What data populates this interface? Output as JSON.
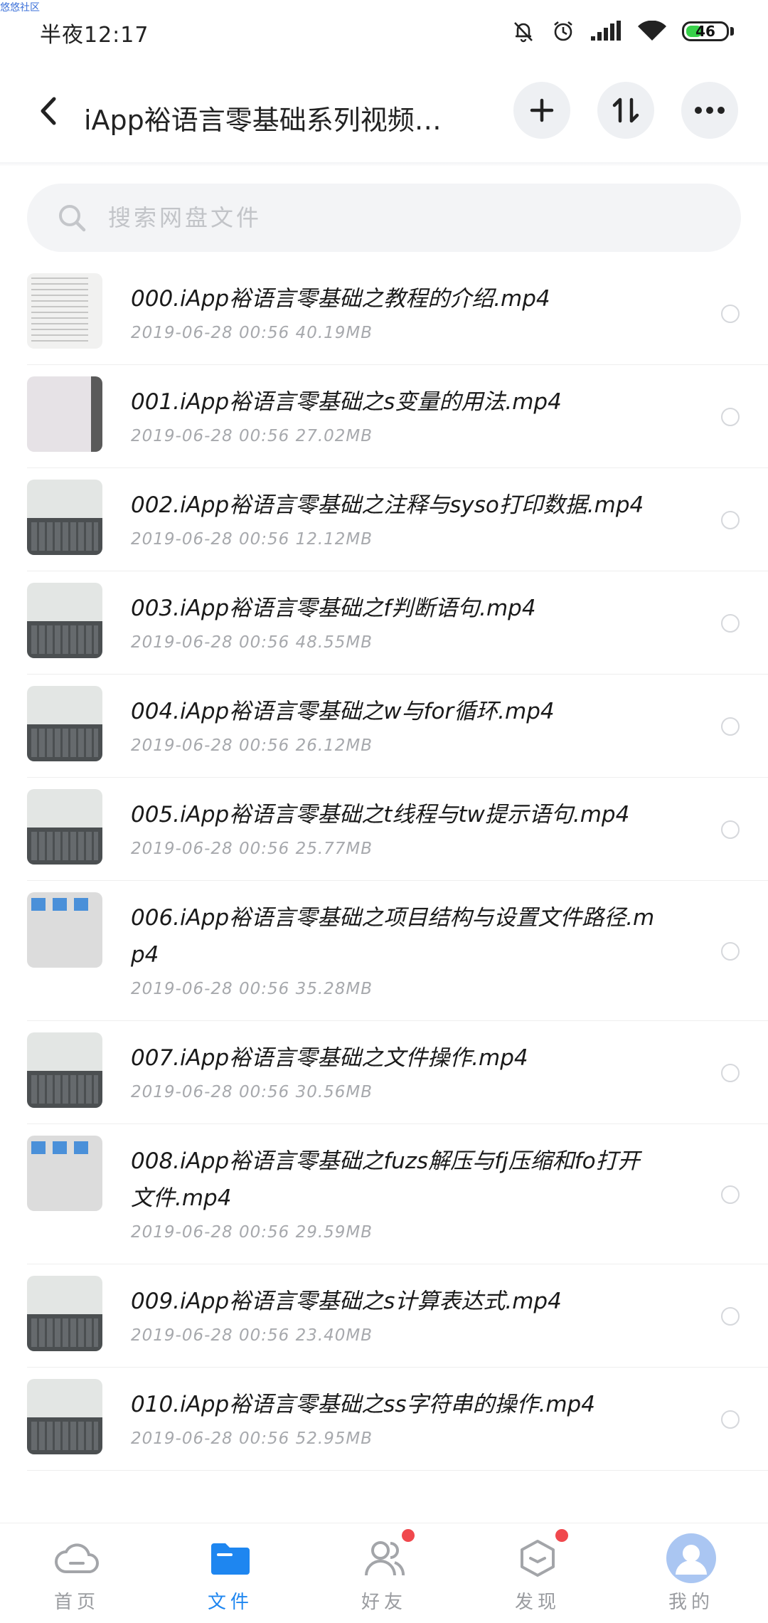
{
  "watermark": "悠悠社区",
  "status_bar": {
    "time": "半夜12:17",
    "battery": "46",
    "battery_level_percent": 46,
    "icons": [
      "mute-icon",
      "alarm-icon",
      "signal-icon",
      "wifi-icon",
      "battery-icon"
    ]
  },
  "header": {
    "title": "iApp裕语言零基础系列视频…",
    "icons": [
      "back-icon",
      "plus-icon",
      "sort-icon",
      "more-icon"
    ]
  },
  "search": {
    "placeholder": "搜索网盘文件"
  },
  "files": [
    {
      "name": "000.iApp裕语言零基础之教程的介绍.mp4",
      "meta": "2019-06-28  00:56  40.19MB"
    },
    {
      "name": "001.iApp裕语言零基础之s变量的用法.mp4",
      "meta": "2019-06-28  00:56  27.02MB"
    },
    {
      "name": "002.iApp裕语言零基础之注释与syso打印数据.mp4",
      "meta": "2019-06-28  00:56  12.12MB"
    },
    {
      "name": "003.iApp裕语言零基础之f判断语句.mp4",
      "meta": "2019-06-28  00:56  48.55MB"
    },
    {
      "name": "004.iApp裕语言零基础之w与for循环.mp4",
      "meta": "2019-06-28  00:56  26.12MB"
    },
    {
      "name": "005.iApp裕语言零基础之t线程与tw提示语句.mp4",
      "meta": "2019-06-28  00:56  25.77MB"
    },
    {
      "name": "006.iApp裕语言零基础之项目结构与设置文件路径.mp4",
      "meta": "2019-06-28  00:56  35.28MB"
    },
    {
      "name": "007.iApp裕语言零基础之文件操作.mp4",
      "meta": "2019-06-28  00:56  30.56MB"
    },
    {
      "name": "008.iApp裕语言零基础之fuzs解压与fj压缩和fo打开文件.mp4",
      "meta": "2019-06-28  00:56  29.59MB"
    },
    {
      "name": "009.iApp裕语言零基础之s计算表达式.mp4",
      "meta": "2019-06-28  00:56  23.40MB"
    },
    {
      "name": "010.iApp裕语言零基础之ss字符串的操作.mp4",
      "meta": "2019-06-28  00:56  52.95MB"
    }
  ],
  "bottom_nav": [
    {
      "label": "首页",
      "icon": "cloud-icon",
      "active": false,
      "badge": false
    },
    {
      "label": "文件",
      "icon": "folder-icon",
      "active": true,
      "badge": false
    },
    {
      "label": "好友",
      "icon": "friends-icon",
      "active": false,
      "badge": true
    },
    {
      "label": "发现",
      "icon": "discover-icon",
      "active": false,
      "badge": true
    },
    {
      "label": "我的",
      "icon": "avatar-icon",
      "active": false,
      "badge": false
    }
  ],
  "colors": {
    "accent": "#1e86f0",
    "badge": "#f0484d",
    "battery": "#38d14a"
  }
}
